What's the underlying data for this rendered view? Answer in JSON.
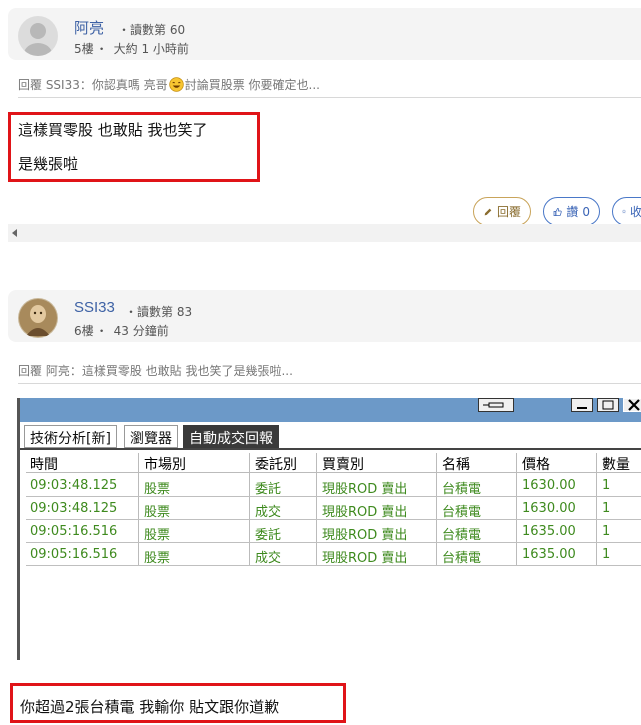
{
  "post1": {
    "username": "阿亮",
    "read_label": "・讀數第 60",
    "floor": "5樓",
    "time": "大約 1 小時前",
    "reply_quote_prefix": "回覆 SSI33：你認真嗎 亮哥",
    "reply_quote_suffix": "討論買股票 你要確定也...",
    "content_lines": [
      "這樣買零股 也敢貼 我也笑了",
      "是幾張啦"
    ],
    "buttons": {
      "reply": "回覆",
      "like": "讚",
      "like_count": "0",
      "more": "收"
    }
  },
  "post2": {
    "username": "SSI33",
    "read_label": "・讀數第 83",
    "floor": "6樓",
    "time": "43 分鐘前",
    "reply_quote": "回覆 阿亮：這樣買零股 也敢貼 我也笑了是幾張啦...",
    "content": "你超過2張台積電 我輸你 貼文跟你道歉"
  },
  "embedded_window": {
    "tabs": [
      "技術分析[新]",
      "瀏覽器",
      "自動成交回報"
    ],
    "columns": [
      "時間",
      "市場別",
      "委託別",
      "買賣別",
      "名稱",
      "價格",
      "數量"
    ],
    "rows": [
      [
        "09:03:48.125",
        "股票",
        "委託",
        "現股ROD 賣出",
        "台積電",
        "1630.00",
        "1"
      ],
      [
        "09:03:48.125",
        "股票",
        "成交",
        "現股ROD 賣出",
        "台積電",
        "1630.00",
        "1"
      ],
      [
        "09:05:16.516",
        "股票",
        "委託",
        "現股ROD 賣出",
        "台積電",
        "1635.00",
        "1"
      ],
      [
        "09:05:16.516",
        "股票",
        "成交",
        "現股ROD 賣出",
        "台積電",
        "1635.00",
        "1"
      ]
    ]
  },
  "colors": {
    "username": "#3e62a5",
    "highlight_box": "#e01418",
    "deal_text": "#3e8a1e"
  }
}
